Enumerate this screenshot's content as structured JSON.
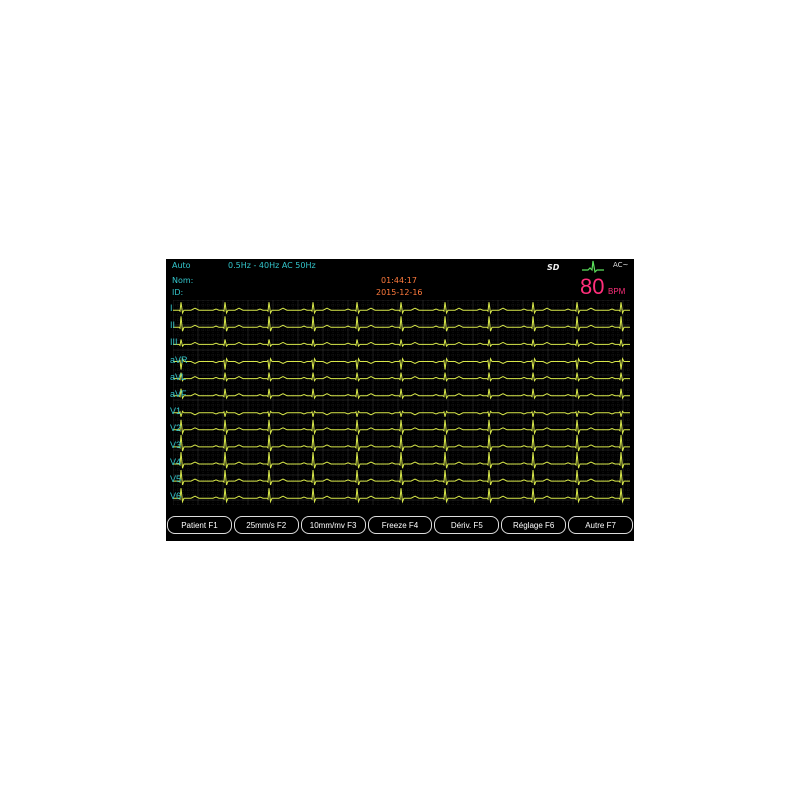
{
  "status_bar": {
    "mode": "Auto",
    "filter": "0.5Hz - 40Hz  AC 50Hz",
    "sd_icon": "sd-card-icon",
    "heartbeat_icon": "heartbeat-icon",
    "ac_label": "AC~"
  },
  "patient": {
    "name_label": "Nom:",
    "id_label": "ID:"
  },
  "clock": {
    "time": "01:44:17",
    "date": "2015-12-16"
  },
  "heart_rate": {
    "value": "80",
    "unit": "BPM"
  },
  "leads": [
    "I",
    "II",
    "III",
    "aVR",
    "aVL",
    "aVF",
    "V1",
    "V2",
    "V3",
    "V4",
    "V5",
    "V6"
  ],
  "softkeys": [
    "Patient F1",
    "25mm/s F2",
    "10mm/mv F3",
    "Freeze F4",
    "Dériv. F5",
    "Réglage F6",
    "Autre F7"
  ],
  "colors": {
    "trace": "#d8e84a",
    "label": "#33c6cc",
    "bpm": "#ff2e7a",
    "clock": "#ff7a3c",
    "grid": "#2a2a2a"
  }
}
